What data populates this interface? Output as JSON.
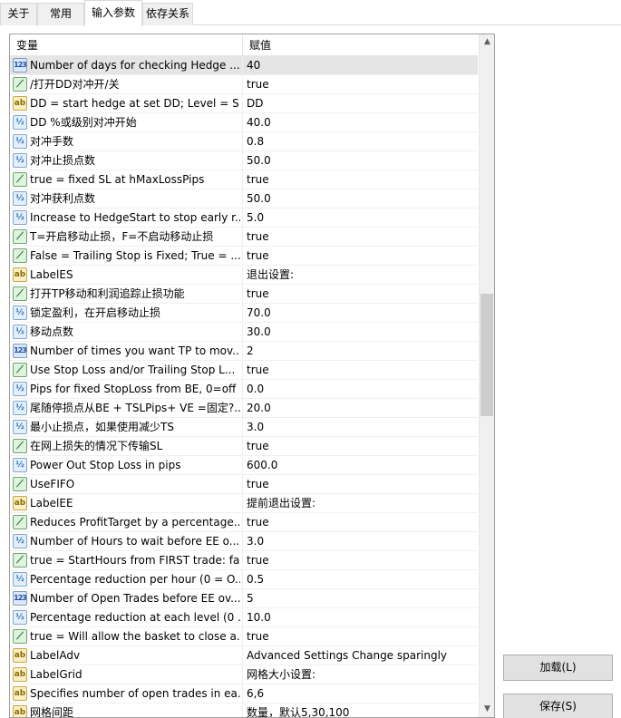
{
  "tabs": [
    {
      "label": "关于"
    },
    {
      "label": "常用"
    },
    {
      "label": "输入参数"
    },
    {
      "label": "依存关系"
    }
  ],
  "grid": {
    "col_variable": "变量",
    "col_value": "赋值",
    "rows": [
      {
        "type": "int",
        "icon_text": "123",
        "name": "Number of days for checking Hedge ...",
        "value": "40",
        "selected": true
      },
      {
        "type": "bool",
        "icon_text": "⟋",
        "name": "/打开DD对冲开/关",
        "value": "true"
      },
      {
        "type": "str",
        "icon_text": "ab",
        "name": "DD = start hedge at set DD; Level = S...",
        "value": "DD"
      },
      {
        "type": "dbl",
        "icon_text": "½",
        "name": "DD %或级别对冲开始",
        "value": "40.0"
      },
      {
        "type": "dbl",
        "icon_text": "½",
        "name": "对冲手数",
        "value": "0.8"
      },
      {
        "type": "dbl",
        "icon_text": "½",
        "name": "对冲止损点数",
        "value": "50.0"
      },
      {
        "type": "bool",
        "icon_text": "⟋",
        "name": "true = fixed SL at hMaxLossPips",
        "value": "true"
      },
      {
        "type": "dbl",
        "icon_text": "½",
        "name": "对冲获利点数",
        "value": "50.0"
      },
      {
        "type": "dbl",
        "icon_text": "½",
        "name": "Increase to HedgeStart to stop early r...",
        "value": "5.0"
      },
      {
        "type": "bool",
        "icon_text": "⟋",
        "name": "T=开启移动止损，F=不启动移动止损",
        "value": "true"
      },
      {
        "type": "bool",
        "icon_text": "⟋",
        "name": "False = Trailing Stop is Fixed; True = ...",
        "value": "true"
      },
      {
        "type": "str",
        "icon_text": "ab",
        "name": "LabelES",
        "value": "退出设置:"
      },
      {
        "type": "bool",
        "icon_text": "⟋",
        "name": "打开TP移动和利润追踪止损功能",
        "value": "true"
      },
      {
        "type": "dbl",
        "icon_text": "½",
        "name": "锁定盈利，在开启移动止损",
        "value": "70.0"
      },
      {
        "type": "dbl",
        "icon_text": "½",
        "name": "移动点数",
        "value": "30.0"
      },
      {
        "type": "int",
        "icon_text": "123",
        "name": "Number of times you want TP to mov...",
        "value": "2"
      },
      {
        "type": "bool",
        "icon_text": "⟋",
        "name": "Use Stop Loss and/or Trailing Stop L...",
        "value": "true"
      },
      {
        "type": "dbl",
        "icon_text": "½",
        "name": "Pips for fixed StopLoss from BE, 0=off",
        "value": "0.0"
      },
      {
        "type": "dbl",
        "icon_text": "½",
        "name": "尾随停损点从BE + TSLPips+ VE =固定?...",
        "value": "20.0"
      },
      {
        "type": "dbl",
        "icon_text": "½",
        "name": "最小止损点，如果使用减少TS",
        "value": "3.0"
      },
      {
        "type": "bool",
        "icon_text": "⟋",
        "name": "在网上损失的情况下传输SL",
        "value": "true"
      },
      {
        "type": "dbl",
        "icon_text": "½",
        "name": "Power Out Stop Loss in pips",
        "value": "600.0"
      },
      {
        "type": "bool",
        "icon_text": "⟋",
        "name": "UseFIFO",
        "value": "true"
      },
      {
        "type": "str",
        "icon_text": "ab",
        "name": "LabelEE",
        "value": "提前退出设置:"
      },
      {
        "type": "bool",
        "icon_text": "⟋",
        "name": "Reduces ProfitTarget by a percentage...",
        "value": "true"
      },
      {
        "type": "dbl",
        "icon_text": "½",
        "name": "Number of Hours to wait before EE o...",
        "value": "3.0"
      },
      {
        "type": "bool",
        "icon_text": "⟋",
        "name": "true = StartHours from FIRST trade: fa...",
        "value": "true"
      },
      {
        "type": "dbl",
        "icon_text": "½",
        "name": "Percentage reduction per hour (0 = O...",
        "value": "0.5"
      },
      {
        "type": "int",
        "icon_text": "123",
        "name": "Number of Open Trades before EE ov...",
        "value": "5"
      },
      {
        "type": "dbl",
        "icon_text": "½",
        "name": "Percentage reduction at each level (0 ...",
        "value": "10.0"
      },
      {
        "type": "bool",
        "icon_text": "⟋",
        "name": "true = Will allow the basket to close a...",
        "value": "true"
      },
      {
        "type": "str",
        "icon_text": "ab",
        "name": "LabelAdv",
        "value": "Advanced Settings Change sparingly"
      },
      {
        "type": "str",
        "icon_text": "ab",
        "name": "LabelGrid",
        "value": "网格大小设置:"
      },
      {
        "type": "str",
        "icon_text": "ab",
        "name": "Specifies number of open trades in ea...",
        "value": "6,6"
      },
      {
        "type": "str",
        "icon_text": "ab",
        "name": "网格间距",
        "value": "数量，默认5,30,100"
      }
    ]
  },
  "buttons": {
    "load_label": "加载(L)",
    "save_label": "保存(S)"
  }
}
